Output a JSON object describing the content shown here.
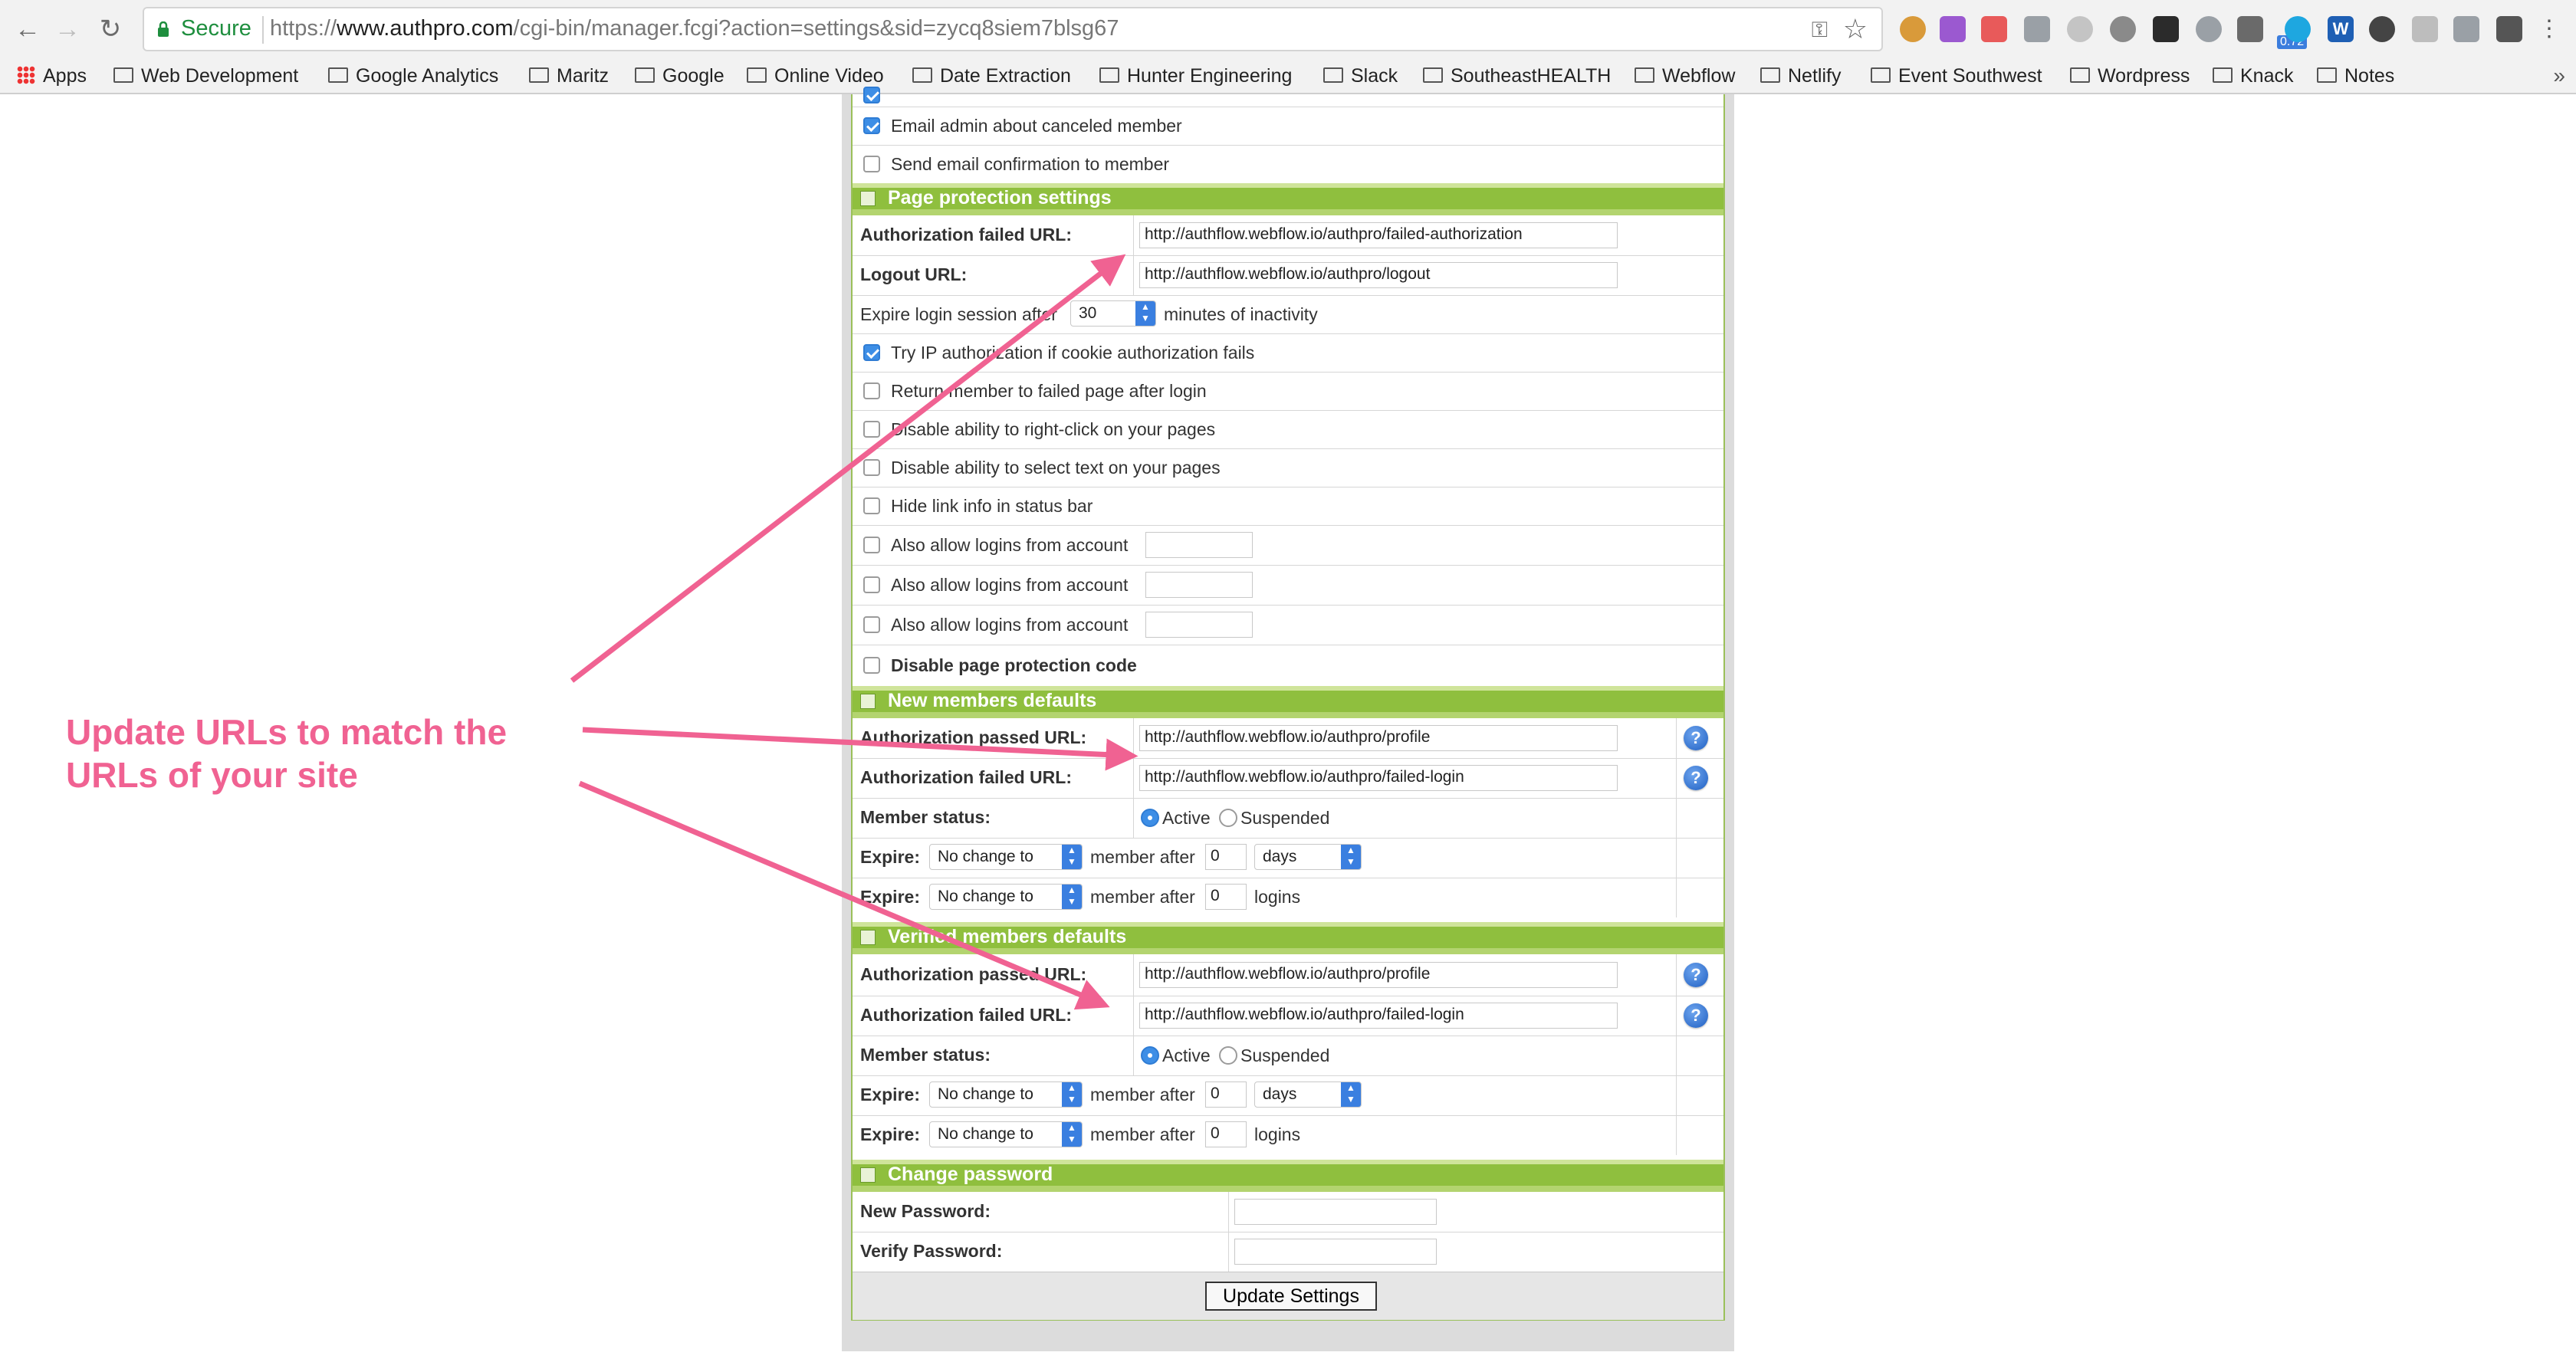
{
  "browser": {
    "secure_label": "Secure",
    "url_scheme": "https://",
    "url_host": "www.authpro.com",
    "url_path": "/cgi-bin/manager.fcgi?action=settings&sid=zycq8siem7blsg67",
    "ext_badge": "0.72",
    "ext_w_label": "W"
  },
  "bookmarks": {
    "apps": "Apps",
    "items": [
      "Web Development",
      "Google Analytics",
      "Maritz",
      "Google",
      "Online Video",
      "Date Extraction",
      "Hunter Engineering",
      "Slack",
      "SoutheastHEALTH",
      "Webflow",
      "Netlify",
      "Event Southwest",
      "Wordpress",
      "Knack",
      "Notes"
    ],
    "more": "»"
  },
  "settings": {
    "email_admin_canceled": "Email admin about canceled member",
    "send_confirmation": "Send email confirmation to member",
    "page_protection": {
      "title": "Page protection settings",
      "auth_failed_label": "Authorization failed URL:",
      "auth_failed_value": "http://authflow.webflow.io/authpro/failed-authorization",
      "logout_label": "Logout URL:",
      "logout_value": "http://authflow.webflow.io/authpro/logout",
      "expire_prefix": "Expire login session after",
      "expire_value": "30",
      "expire_suffix": "minutes of inactivity",
      "try_ip": "Try IP authorization if cookie authorization fails",
      "return_member": "Return member to failed page after login",
      "disable_right_click": "Disable ability to right-click on your pages",
      "disable_select": "Disable ability to select text on your pages",
      "hide_link": "Hide link info in status bar",
      "also_allow": "Also allow logins from account",
      "disable_code": "Disable page protection code"
    },
    "new_members": {
      "title": "New members defaults",
      "passed_label": "Authorization passed URL:",
      "passed_value": "http://authflow.webflow.io/authpro/profile",
      "failed_label": "Authorization failed URL:",
      "failed_value": "http://authflow.webflow.io/authpro/failed-login",
      "status_label": "Member status:",
      "active": "Active",
      "suspended": "Suspended",
      "expire_label": "Expire:",
      "no_change": "No change to",
      "member_after": "member after",
      "zero": "0",
      "days": "days",
      "logins": "logins"
    },
    "verified_members": {
      "title": "Verified members defaults",
      "passed_label": "Authorization passed URL:",
      "passed_value": "http://authflow.webflow.io/authpro/profile",
      "failed_label": "Authorization failed URL:",
      "failed_value": "http://authflow.webflow.io/authpro/failed-login",
      "status_label": "Member status:",
      "active": "Active",
      "suspended": "Suspended",
      "expire_label": "Expire:",
      "no_change": "No change to",
      "member_after": "member after",
      "zero": "0",
      "days": "days",
      "logins": "logins"
    },
    "change_password": {
      "title": "Change password",
      "new_label": "New Password:",
      "verify_label": "Verify Password:"
    },
    "update_button": "Update Settings",
    "help_glyph": "?"
  },
  "annotation": {
    "line1": "Update URLs to match the",
    "line2": "URLs of your site",
    "color": "#f06292"
  },
  "colors": {
    "section_header": "#8fbf3e",
    "checkbox_on": "#3d8ee6",
    "secure_green": "#1e8e3e"
  }
}
